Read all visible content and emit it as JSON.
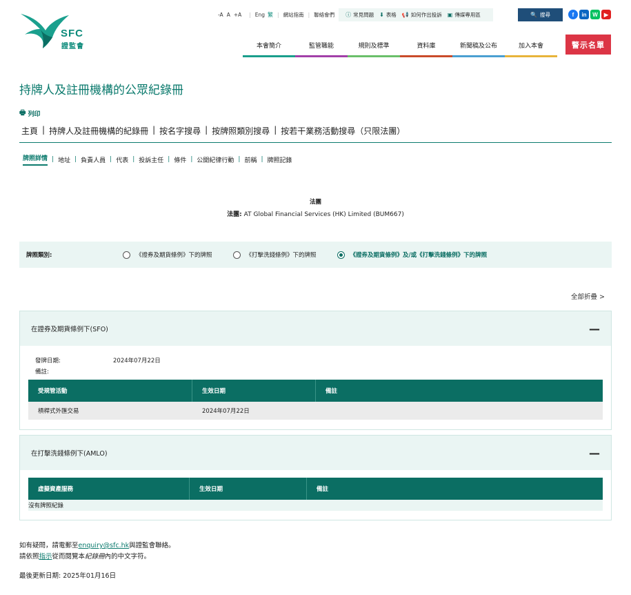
{
  "logo": {
    "brand": "SFC",
    "brand_cn": "證監會",
    "color": "#0b8a7a"
  },
  "utility": {
    "font_sizes": [
      "-A",
      "A",
      "+A"
    ],
    "lang": "Eng",
    "lang_icon": "繁",
    "site_guide": "網站指南",
    "contact": "聯絡會們",
    "faq": "常見問題",
    "forms": "表格",
    "complaint": "如何作出投訴",
    "media": "傳媒專用區",
    "search": "搜尋"
  },
  "social": {
    "facebook": "f",
    "linkedin": "in",
    "wechat": "W",
    "youtube": "▶"
  },
  "nav": [
    {
      "label": "本會簡介",
      "color": "#1a9e8c"
    },
    {
      "label": "監管職能",
      "color": "#a23fa8"
    },
    {
      "label": "規則及標準",
      "color": "#6abf69"
    },
    {
      "label": "資料庫",
      "color": "#c94b2a"
    },
    {
      "label": "新聞稿及公布",
      "color": "#4a9fd1"
    },
    {
      "label": "加入本會",
      "color": "#e8b43a"
    }
  ],
  "alert_list": "警示名單",
  "page_title": "持牌人及註冊機構的公眾紀錄冊",
  "print": "列印",
  "breadcrumb": [
    "主頁",
    "持牌人及註冊機構的紀錄冊",
    "按名字搜尋",
    "按牌照類別搜尋",
    "按若干業務活動搜尋（只限法團）"
  ],
  "subtabs": [
    "牌照詳情",
    "地址",
    "負責人員",
    "代表",
    "投訴主任",
    "條件",
    "公開紀律行動",
    "前稱",
    "牌照記錄"
  ],
  "entity": {
    "type": "法團",
    "name_label": "法團:",
    "name": "AT Global Financial Services (HK) Limited (BUM667)"
  },
  "license_type": {
    "label": "牌照類別:",
    "options": [
      {
        "label": "《證券及期貨條例》下的牌照",
        "checked": false
      },
      {
        "label": "《打擊洗錢條例》下的牌照",
        "checked": false
      },
      {
        "label": "《證券及期貨條例》及/或《打擊洗錢條例》下的牌照",
        "checked": true
      }
    ]
  },
  "collapse_all": "全部折疊 >",
  "sfo": {
    "title": "在證券及期貨條例下(SFO)",
    "toggle": "—",
    "issue_date_label": "發牌日期:",
    "issue_date": "2024年07月22日",
    "remarks_label": "備註:",
    "columns": [
      "受規管活動",
      "生效日期",
      "備註"
    ],
    "rows": [
      [
        "槓桿式外匯交易",
        "2024年07月22日",
        ""
      ]
    ]
  },
  "amlo": {
    "title": "在打擊洗錢條例下(AMLO)",
    "toggle": "—",
    "columns": [
      "虛擬資產服務",
      "生效日期",
      "備註"
    ],
    "empty": "沒有牌照紀錄"
  },
  "footer": {
    "line1_pre": "如有疑問，請電郵至",
    "email": "enquiry@sfc.hk",
    "line1_post": "與證監會聯絡。",
    "line2_pre": "請依照",
    "guide_link": "指示",
    "line2_mid": "從而閱覽本",
    "line2_italic": "紀錄冊",
    "line2_post": "內的中文字符。",
    "last_updated": "最後更新日期: 2025年01月16日"
  }
}
